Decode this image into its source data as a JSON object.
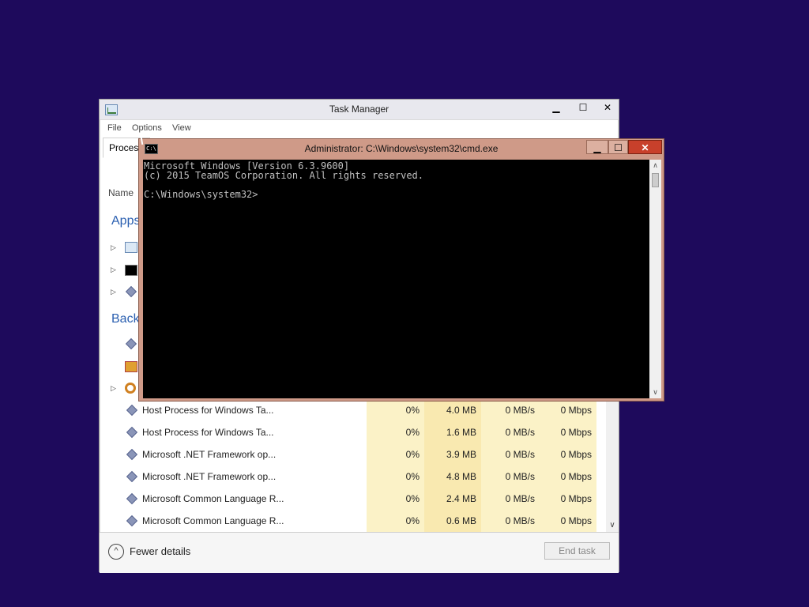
{
  "taskmanager": {
    "title": "Task Manager",
    "min_glyph": "▁",
    "max_glyph": "☐",
    "close_glyph": "✕",
    "menu": [
      "File",
      "Options",
      "View"
    ],
    "tab_processes": "Process",
    "column_name": "Name",
    "section_apps": "Apps",
    "section_background": "Back",
    "rows": [
      {
        "name": "Host Process for Windows Ta...",
        "cpu": "0%",
        "memory": "4.0 MB",
        "disk": "0 MB/s",
        "network": "0 Mbps"
      },
      {
        "name": "Host Process for Windows Ta...",
        "cpu": "0%",
        "memory": "1.6 MB",
        "disk": "0 MB/s",
        "network": "0 Mbps"
      },
      {
        "name": "Microsoft .NET Framework op...",
        "cpu": "0%",
        "memory": "3.9 MB",
        "disk": "0 MB/s",
        "network": "0 Mbps"
      },
      {
        "name": "Microsoft .NET Framework op...",
        "cpu": "0%",
        "memory": "4.8 MB",
        "disk": "0 MB/s",
        "network": "0 Mbps"
      },
      {
        "name": "Microsoft Common Language R...",
        "cpu": "0%",
        "memory": "2.4 MB",
        "disk": "0 MB/s",
        "network": "0 Mbps"
      },
      {
        "name": "Microsoft Common Language R...",
        "cpu": "0%",
        "memory": "0.6 MB",
        "disk": "0 MB/s",
        "network": "0 Mbps"
      }
    ],
    "fewer_details": "Fewer details",
    "end_task": "End task",
    "fewer_icon_glyph": "^",
    "scroll_down_glyph": "∨",
    "tree_arrow_glyph": "▷"
  },
  "cmd": {
    "title": "Administrator: C:\\Windows\\system32\\cmd.exe",
    "icon_label": "C:\\",
    "min_glyph": "▁",
    "max_glyph": "☐",
    "close_glyph": "✕",
    "scroll_up_glyph": "∧",
    "scroll_down_glyph": "∨",
    "lines": [
      "Microsoft Windows [Version 6.3.9600]",
      "(c) 2015 TeamOS Corporation. All rights reserved.",
      "",
      "C:\\Windows\\system32>"
    ]
  },
  "colors": {
    "desktop": "#1e0a5c",
    "cmd_frame": "#cf9a88",
    "cmd_close": "#c8402b",
    "console_bg": "#000000",
    "console_text": "#c0c0c0",
    "column_highlight": "#fbf2c7",
    "section_header": "#2a5fb0"
  }
}
